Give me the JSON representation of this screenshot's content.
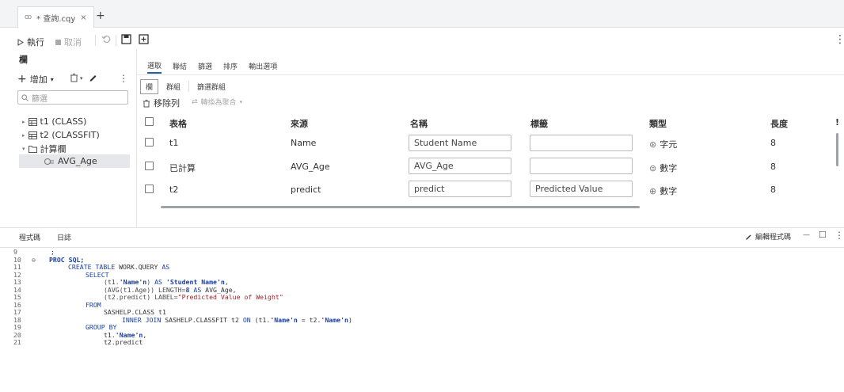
{
  "tabbar": {
    "tab_icon": "ꝏ",
    "tab_label": "* 查詢.cqy",
    "close": "×",
    "add": "+"
  },
  "toolbar": {
    "run_label": "執行",
    "cancel_label": "取消",
    "more": "⋮"
  },
  "left": {
    "title": "欄",
    "add_label": "增加",
    "search_placeholder": "篩選",
    "tree": [
      {
        "label": "t1 (CLASS)"
      },
      {
        "label": "t2 (CLASSFIT)"
      },
      {
        "label": "計算欄"
      },
      {
        "label": "AVG_Age"
      }
    ]
  },
  "right": {
    "tabs": [
      "選取",
      "聯結",
      "篩選",
      "排序",
      "輸出選項"
    ],
    "subtabs": [
      "欄",
      "群組",
      "篩選群組"
    ],
    "remove_label": "移除列",
    "group_label": "轉換為聚合"
  },
  "grid": {
    "headers": [
      "表格",
      "來源",
      "名稱",
      "標籤",
      "類型",
      "長度"
    ],
    "rows": [
      {
        "table": "t1",
        "source": "Name",
        "name": "Student Name",
        "label": "",
        "type": "字元",
        "length": "8"
      },
      {
        "table": "已計算",
        "source": "AVG_Age",
        "name": "AVG_Age",
        "label": "",
        "type": "數字",
        "length": "8"
      },
      {
        "table": "t2",
        "source": "predict",
        "name": "predict",
        "label": "Predicted Value",
        "type": "數字",
        "length": "8"
      }
    ]
  },
  "bottom": {
    "tabs": [
      "程式碼",
      "日誌"
    ],
    "edit_label": "編輯程式碼",
    "minimize": "—",
    "maximize": "☐",
    "more": "⋮"
  },
  "code": {
    "line_numbers": [
      "9",
      "10",
      "11",
      "12",
      "13",
      "14",
      "15",
      "16",
      "17",
      "18",
      "19",
      "20",
      "21"
    ],
    "fold_icon": "⊖",
    "l9": ";",
    "l10": "PROC SQL;",
    "l11_kw": "CREATE TABLE",
    "l11_rest": " WORK.QUERY ",
    "l11_as": "AS",
    "l12": "SELECT",
    "l13_a": "(t1.",
    "l13_b": "'Name'n",
    "l13_c": ") ",
    "l13_d": "AS",
    "l13_e": " ",
    "l13_f": "'Student Name'n",
    "l13_g": ",",
    "l14_a": "(AVG(t1.Age)) LENGTH=",
    "l14_b": "8",
    "l14_c": " ",
    "l14_d": "AS",
    "l14_e": " AVG_Age,",
    "l15_a": "(t2.predict) LABEL=",
    "l15_b": "\"Predicted Value of Weight\"",
    "l16": "FROM",
    "l17": "SASHELP.CLASS t1",
    "l18_a": "INNER JOIN",
    "l18_b": " SASHELP.CLASSFIT t2 ",
    "l18_c": "ON",
    "l18_d": " (t1.",
    "l18_e": "'Name'n",
    "l18_f": " = t2.",
    "l18_g": "'Name'n",
    "l18_h": ")",
    "l19": "GROUP BY",
    "l20_a": "t1.",
    "l20_b": "'Name'n",
    "l20_c": ",",
    "l21": "t2.predict"
  }
}
